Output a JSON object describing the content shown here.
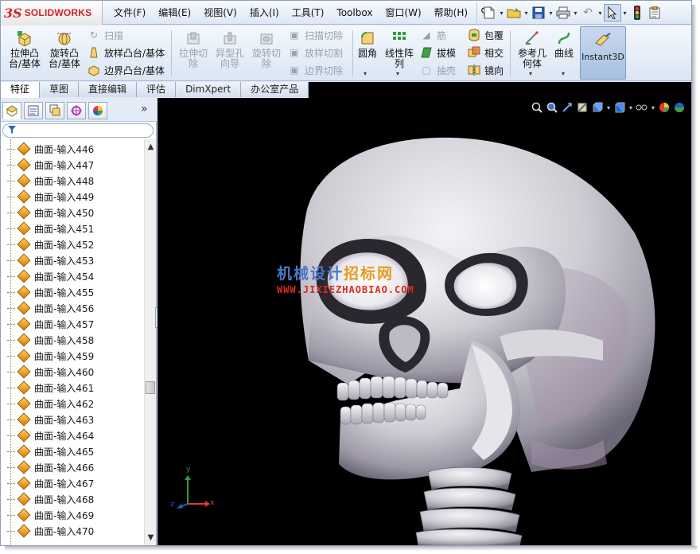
{
  "app": {
    "brand_symbol": "3S",
    "brand_name": "SOLIDWORKS"
  },
  "menu": [
    "文件(F)",
    "编辑(E)",
    "视图(V)",
    "插入(I)",
    "工具(T)",
    "Toolbox",
    "窗口(W)",
    "帮助(H)"
  ],
  "ribbon": {
    "extrude_boss": "拉伸凸\n台/基体",
    "revolve_boss": "旋转凸\n台/基体",
    "sweep": "扫描",
    "loft_boss": "放样凸台/基体",
    "boundary_boss": "边界凸台/基体",
    "extrude_cut": "拉伸切\n除",
    "hole_wizard": "异型孔\n向导",
    "revolve_cut": "旋转切\n除",
    "swept_cut": "扫描切除",
    "lofted_cut": "放样切割",
    "boundary_cut": "边界切除",
    "fillet": "圆角",
    "linear_pattern": "线性阵\n列",
    "rib": "筋",
    "draft": "拔模",
    "shell": "抽壳",
    "wrap": "包覆",
    "intersect": "相交",
    "mirror": "镜向",
    "ref_geometry": "参考几\n何体",
    "curves": "曲线",
    "instant3d": "Instant3D"
  },
  "tabs": [
    {
      "label": "特征",
      "active": true
    },
    {
      "label": "草图",
      "active": false
    },
    {
      "label": "直接编辑",
      "active": false
    },
    {
      "label": "评估",
      "active": false
    },
    {
      "label": "DimXpert",
      "active": false
    },
    {
      "label": "办公室产品",
      "active": false
    }
  ],
  "panel": {
    "more": "»",
    "tree_items": [
      "曲面-输入446",
      "曲面-输入447",
      "曲面-输入448",
      "曲面-输入449",
      "曲面-输入450",
      "曲面-输入451",
      "曲面-输入452",
      "曲面-输入453",
      "曲面-输入454",
      "曲面-输入455",
      "曲面-输入456",
      "曲面-输入457",
      "曲面-输入458",
      "曲面-输入459",
      "曲面-输入460",
      "曲面-输入461",
      "曲面-输入462",
      "曲面-输入463",
      "曲面-输入464",
      "曲面-输入465",
      "曲面-输入466",
      "曲面-输入467",
      "曲面-输入468",
      "曲面-输入469",
      "曲面-输入470"
    ]
  },
  "watermark": {
    "cn_blue": "机械设计",
    "cn_orange": "招标网",
    "url": "WWW.JIXIEZHAOBIAO.COM"
  },
  "triad": {
    "x": "x",
    "y": "y",
    "z": "z"
  },
  "colors": {
    "viewport_bg": "#000000",
    "ribbon_bg": "#dbe5f3",
    "model_bone": "#c8c6cc",
    "brand_red": "#d2232a"
  }
}
